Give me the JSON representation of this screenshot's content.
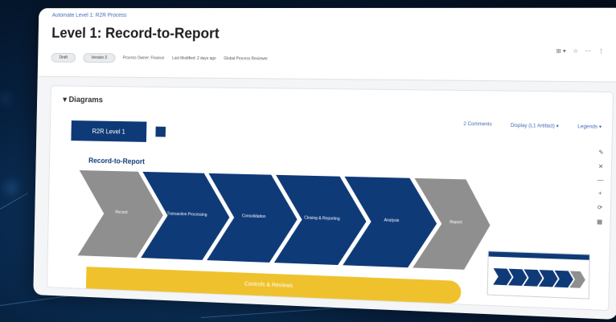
{
  "breadcrumb": "Automate Level 1: R2R Process",
  "title": "Level 1: Record-to-Report",
  "meta": {
    "status_pill": "Draft",
    "version_pill": "Version 3",
    "owner": "Process Owner: Finance",
    "last_modified": "Last Modified: 2 days ago",
    "reviewer": "Global Process Reviewer"
  },
  "top_actions": [
    "⊞ ▾",
    "☆",
    "⋯",
    "⋮"
  ],
  "diagrams": {
    "section_title": "Diagrams",
    "level_button": "R2R Level 1",
    "tool_comments": "2 Comments",
    "tool_display": "Display (L1 Artifact) ▾",
    "tool_legends": "Legends ▾",
    "record_title": "Record-to-Report",
    "steps": [
      "Record",
      "Transaction Processing",
      "Consolidation",
      "Closing & Reporting",
      "Analysis",
      "Report"
    ],
    "bottom_bar": "Controls & Reviews",
    "side_tools": [
      "✎",
      "✕",
      "—",
      "+",
      "⟳",
      "▦"
    ]
  },
  "colors": {
    "navy": "#0f3a78",
    "gray": "#8f8f8f",
    "yellow": "#efc22d"
  }
}
